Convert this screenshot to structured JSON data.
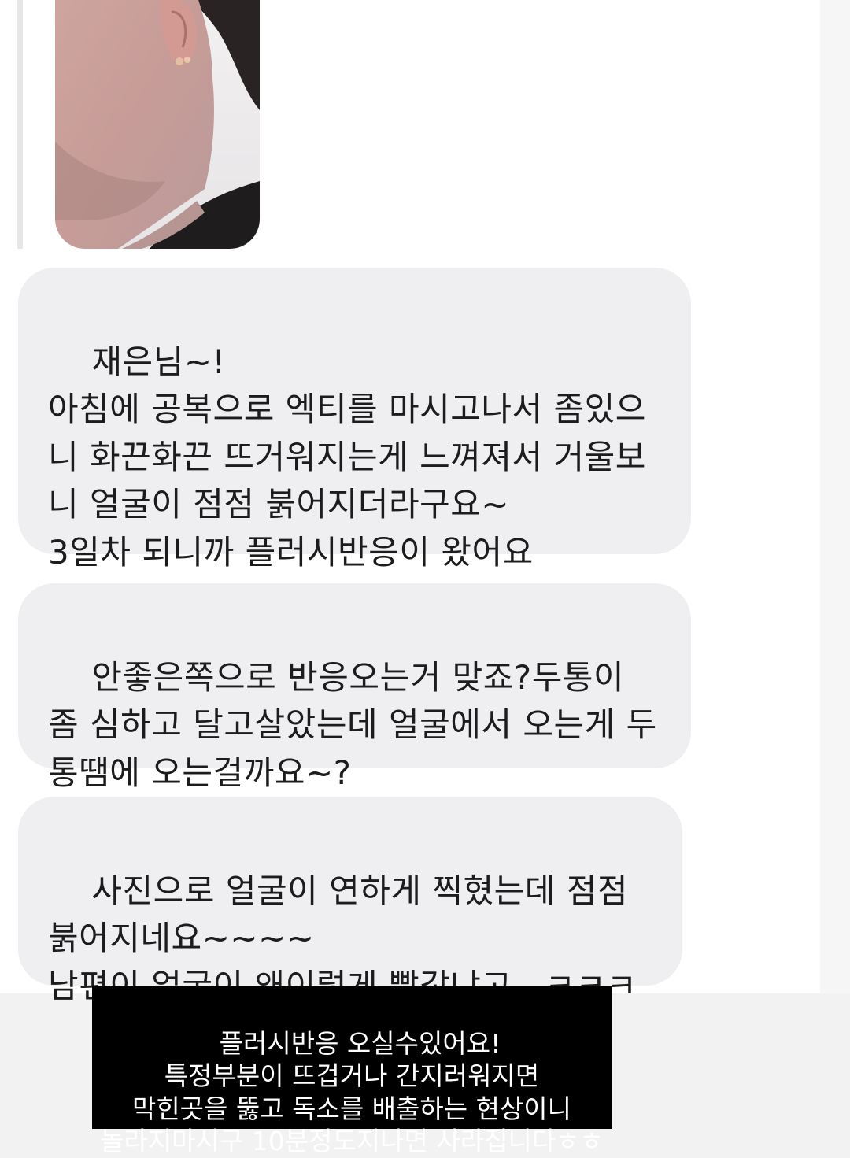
{
  "attached_photo": {
    "description_icon": "photo-thumbnail"
  },
  "messages": [
    {
      "text": "재은님~!\n아침에 공복으로 엑티를 마시고나서 좀있으니 화끈화끈 뜨거워지는게 느껴져서 거울보니 얼굴이 점점 붉어지더라구요~\n3일차 되니까 플러시반응이 왔어요"
    },
    {
      "text": "안좋은쪽으로 반응오는거 맞죠?두통이 좀 심하고 달고살았는데 얼굴에서 오는게 두통땜에 오는걸까요~?"
    },
    {
      "text": "사진으로 얼굴이 연하게 찍혔는데 점점 붉어지네요~~~~\n남편이 얼굴이 왜이렇게 빨갛냐고...ㅋㅋㅋ"
    }
  ],
  "caption": {
    "text": "플러시반응 오실수있어요!\n특정부분이 뜨겁거나 간지러워지면\n막힌곳을 뚫고 독소를 배출하는 현상이니\n놀라지마시구 10분정도지나면 사라집니다ㅎㅎ"
  },
  "colors": {
    "bubble_bg": "#efeff1",
    "text": "#1c1c1e",
    "caption_bg": "#000000",
    "caption_text": "#ffffff"
  }
}
